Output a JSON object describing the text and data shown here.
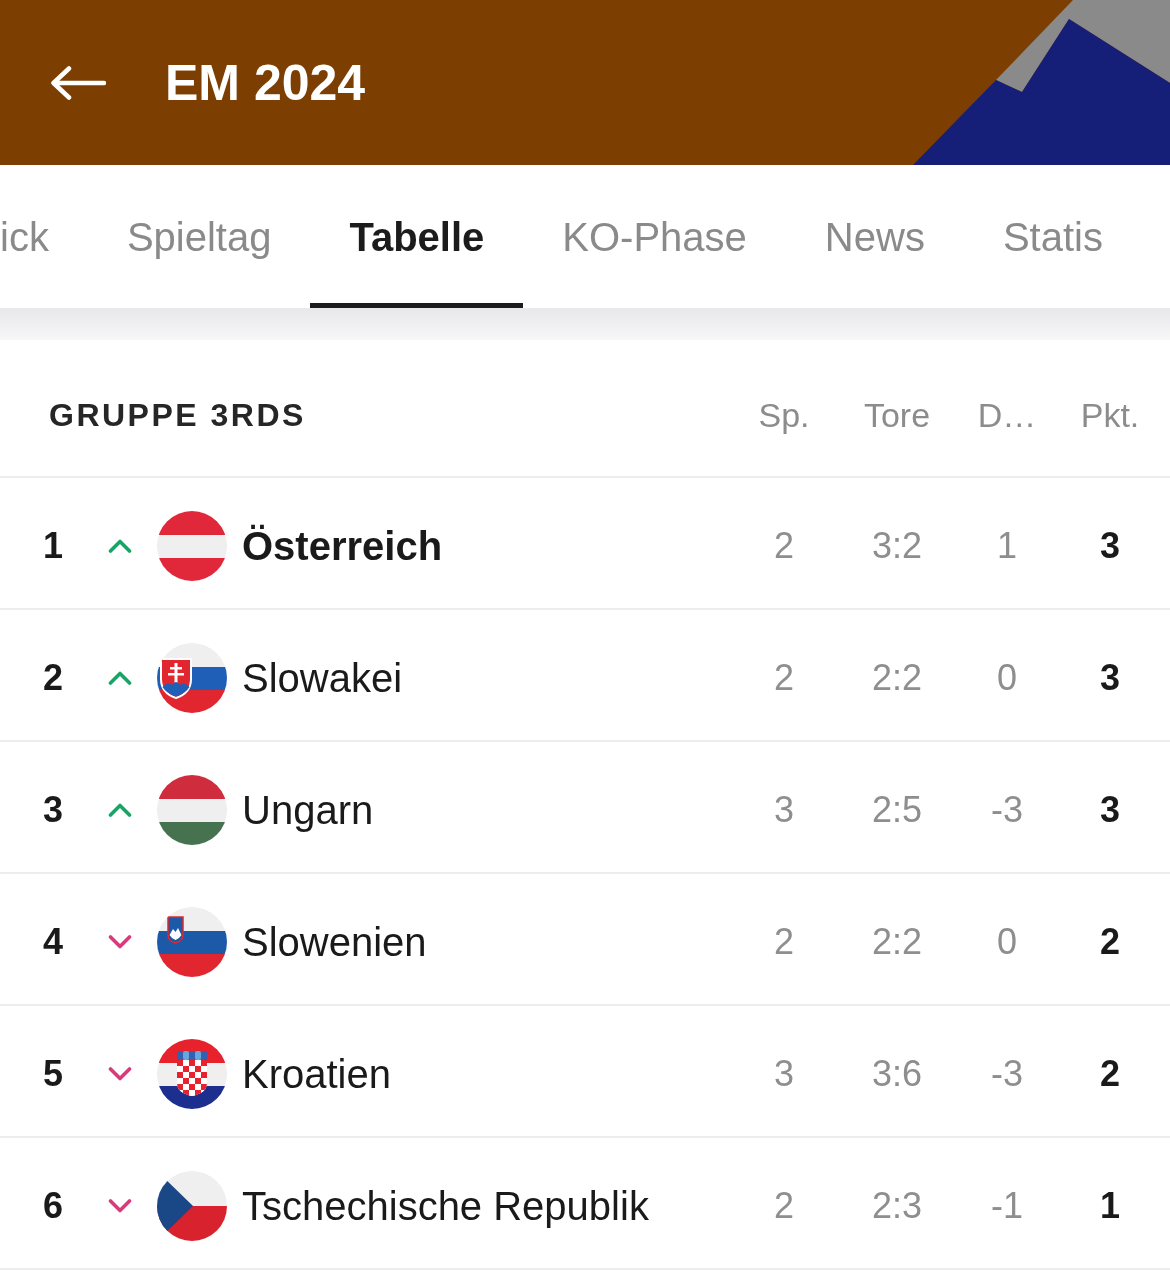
{
  "header": {
    "title": "EM 2024"
  },
  "tabs": [
    {
      "label": "ick",
      "selected": false
    },
    {
      "label": "Spieltag",
      "selected": false
    },
    {
      "label": "Tabelle",
      "selected": true
    },
    {
      "label": "KO-Phase",
      "selected": false
    },
    {
      "label": "News",
      "selected": false
    },
    {
      "label": "Statis",
      "selected": false
    }
  ],
  "table": {
    "title": "GRUPPE 3RDS",
    "columns": [
      "Sp.",
      "Tore",
      "D…",
      "Pkt."
    ],
    "rows": [
      {
        "rank": "1",
        "rising": true,
        "flag": {
          "kind": "austria"
        },
        "team": "Österreich",
        "highlighted": true,
        "played": "2",
        "goals": "3:2",
        "diff": "1",
        "points": "3"
      },
      {
        "rank": "2",
        "rising": true,
        "flag": {
          "kind": "slovakia"
        },
        "team": "Slowakei",
        "highlighted": false,
        "played": "2",
        "goals": "2:2",
        "diff": "0",
        "points": "3"
      },
      {
        "rank": "3",
        "rising": true,
        "flag": {
          "kind": "hungary"
        },
        "team": "Ungarn",
        "highlighted": false,
        "played": "3",
        "goals": "2:5",
        "diff": "-3",
        "points": "3"
      },
      {
        "rank": "4",
        "rising": false,
        "flag": {
          "kind": "slovenia"
        },
        "team": "Slowenien",
        "highlighted": false,
        "played": "2",
        "goals": "2:2",
        "diff": "0",
        "points": "2"
      },
      {
        "rank": "5",
        "rising": false,
        "flag": {
          "kind": "croatia"
        },
        "team": "Kroatien",
        "highlighted": false,
        "played": "3",
        "goals": "3:6",
        "diff": "-3",
        "points": "2"
      },
      {
        "rank": "6",
        "rising": false,
        "flag": {
          "kind": "czechia"
        },
        "team": "Tschechische Republik",
        "highlighted": false,
        "played": "2",
        "goals": "2:3",
        "diff": "-1",
        "points": "1"
      }
    ]
  }
}
